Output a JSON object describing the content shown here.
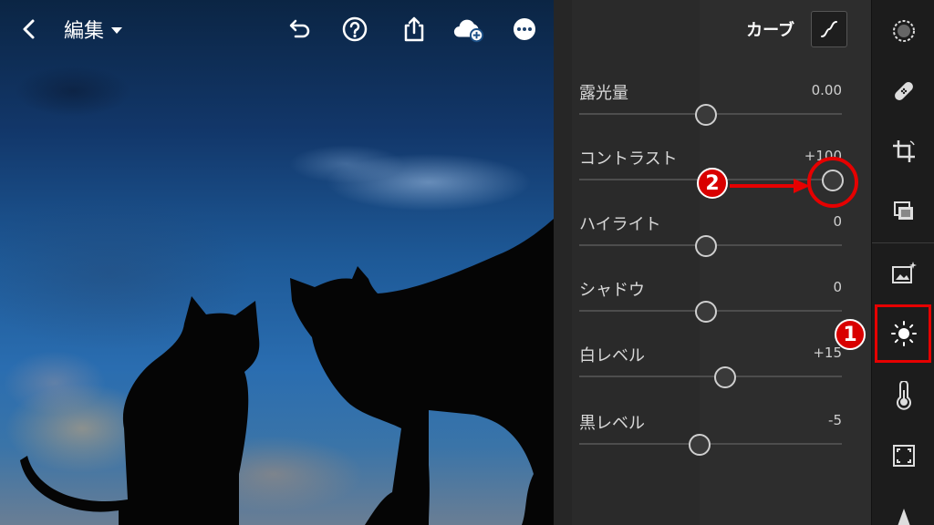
{
  "topbar": {
    "edit_label": "編集",
    "icons": [
      "back-chevron-icon",
      "caret-down-icon",
      "undo-icon",
      "help-icon",
      "share-icon",
      "cloud-add-icon",
      "more-icon"
    ]
  },
  "panel": {
    "curve_label": "カーブ",
    "sliders": [
      {
        "label": "露光量",
        "value": "0.00",
        "position": 0.5
      },
      {
        "label": "コントラスト",
        "value": "+100",
        "position": 1.0
      },
      {
        "label": "ハイライト",
        "value": "0",
        "position": 0.5
      },
      {
        "label": "シャドウ",
        "value": "0",
        "position": 0.5
      },
      {
        "label": "白レベル",
        "value": "+15",
        "position": 0.575
      },
      {
        "label": "黒レベル",
        "value": "-5",
        "position": 0.475
      }
    ]
  },
  "tools": [
    "selective-icon",
    "healing-icon",
    "crop-icon",
    "presets-icon",
    "auto-icon",
    "light-icon",
    "color-icon",
    "effects-icon",
    "detail-icon"
  ],
  "annotations": {
    "badge_1": "1",
    "badge_2": "2",
    "accent_color": "#e60000"
  }
}
